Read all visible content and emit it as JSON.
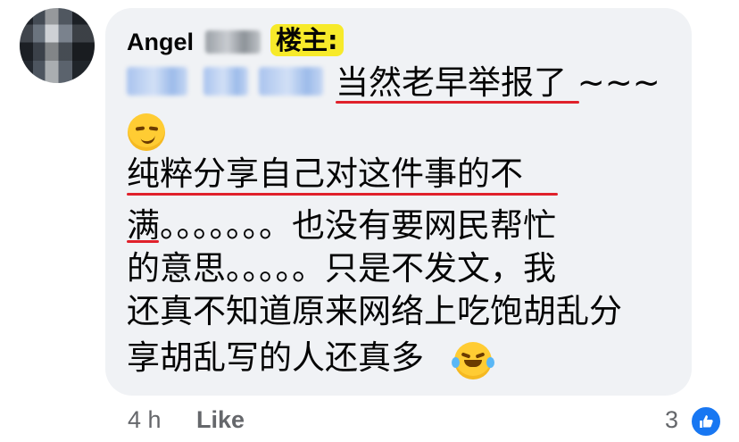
{
  "comment": {
    "author": "Angel",
    "badge": "楼主:",
    "lines": [
      "当然老早举报了 ~~~",
      "纯粹分享自己对这件事的不",
      "满。。。。。。。也没有要网民帮忙",
      "的意思。。。。。只是不发文，我",
      "还真不知道原来网络上吃饱胡乱分",
      "享胡乱写的人还真多"
    ],
    "emojis": [
      "smirk-emoji",
      "tears-of-joy-emoji"
    ]
  },
  "footer": {
    "time": "4 h",
    "like_label": "Like",
    "reaction_count": "3"
  },
  "colors": {
    "bubble": "#f0f2f5",
    "badge": "#f7ea2a",
    "underline": "#e0212b",
    "meta": "#65676b",
    "like_blue": "#1877f2"
  }
}
